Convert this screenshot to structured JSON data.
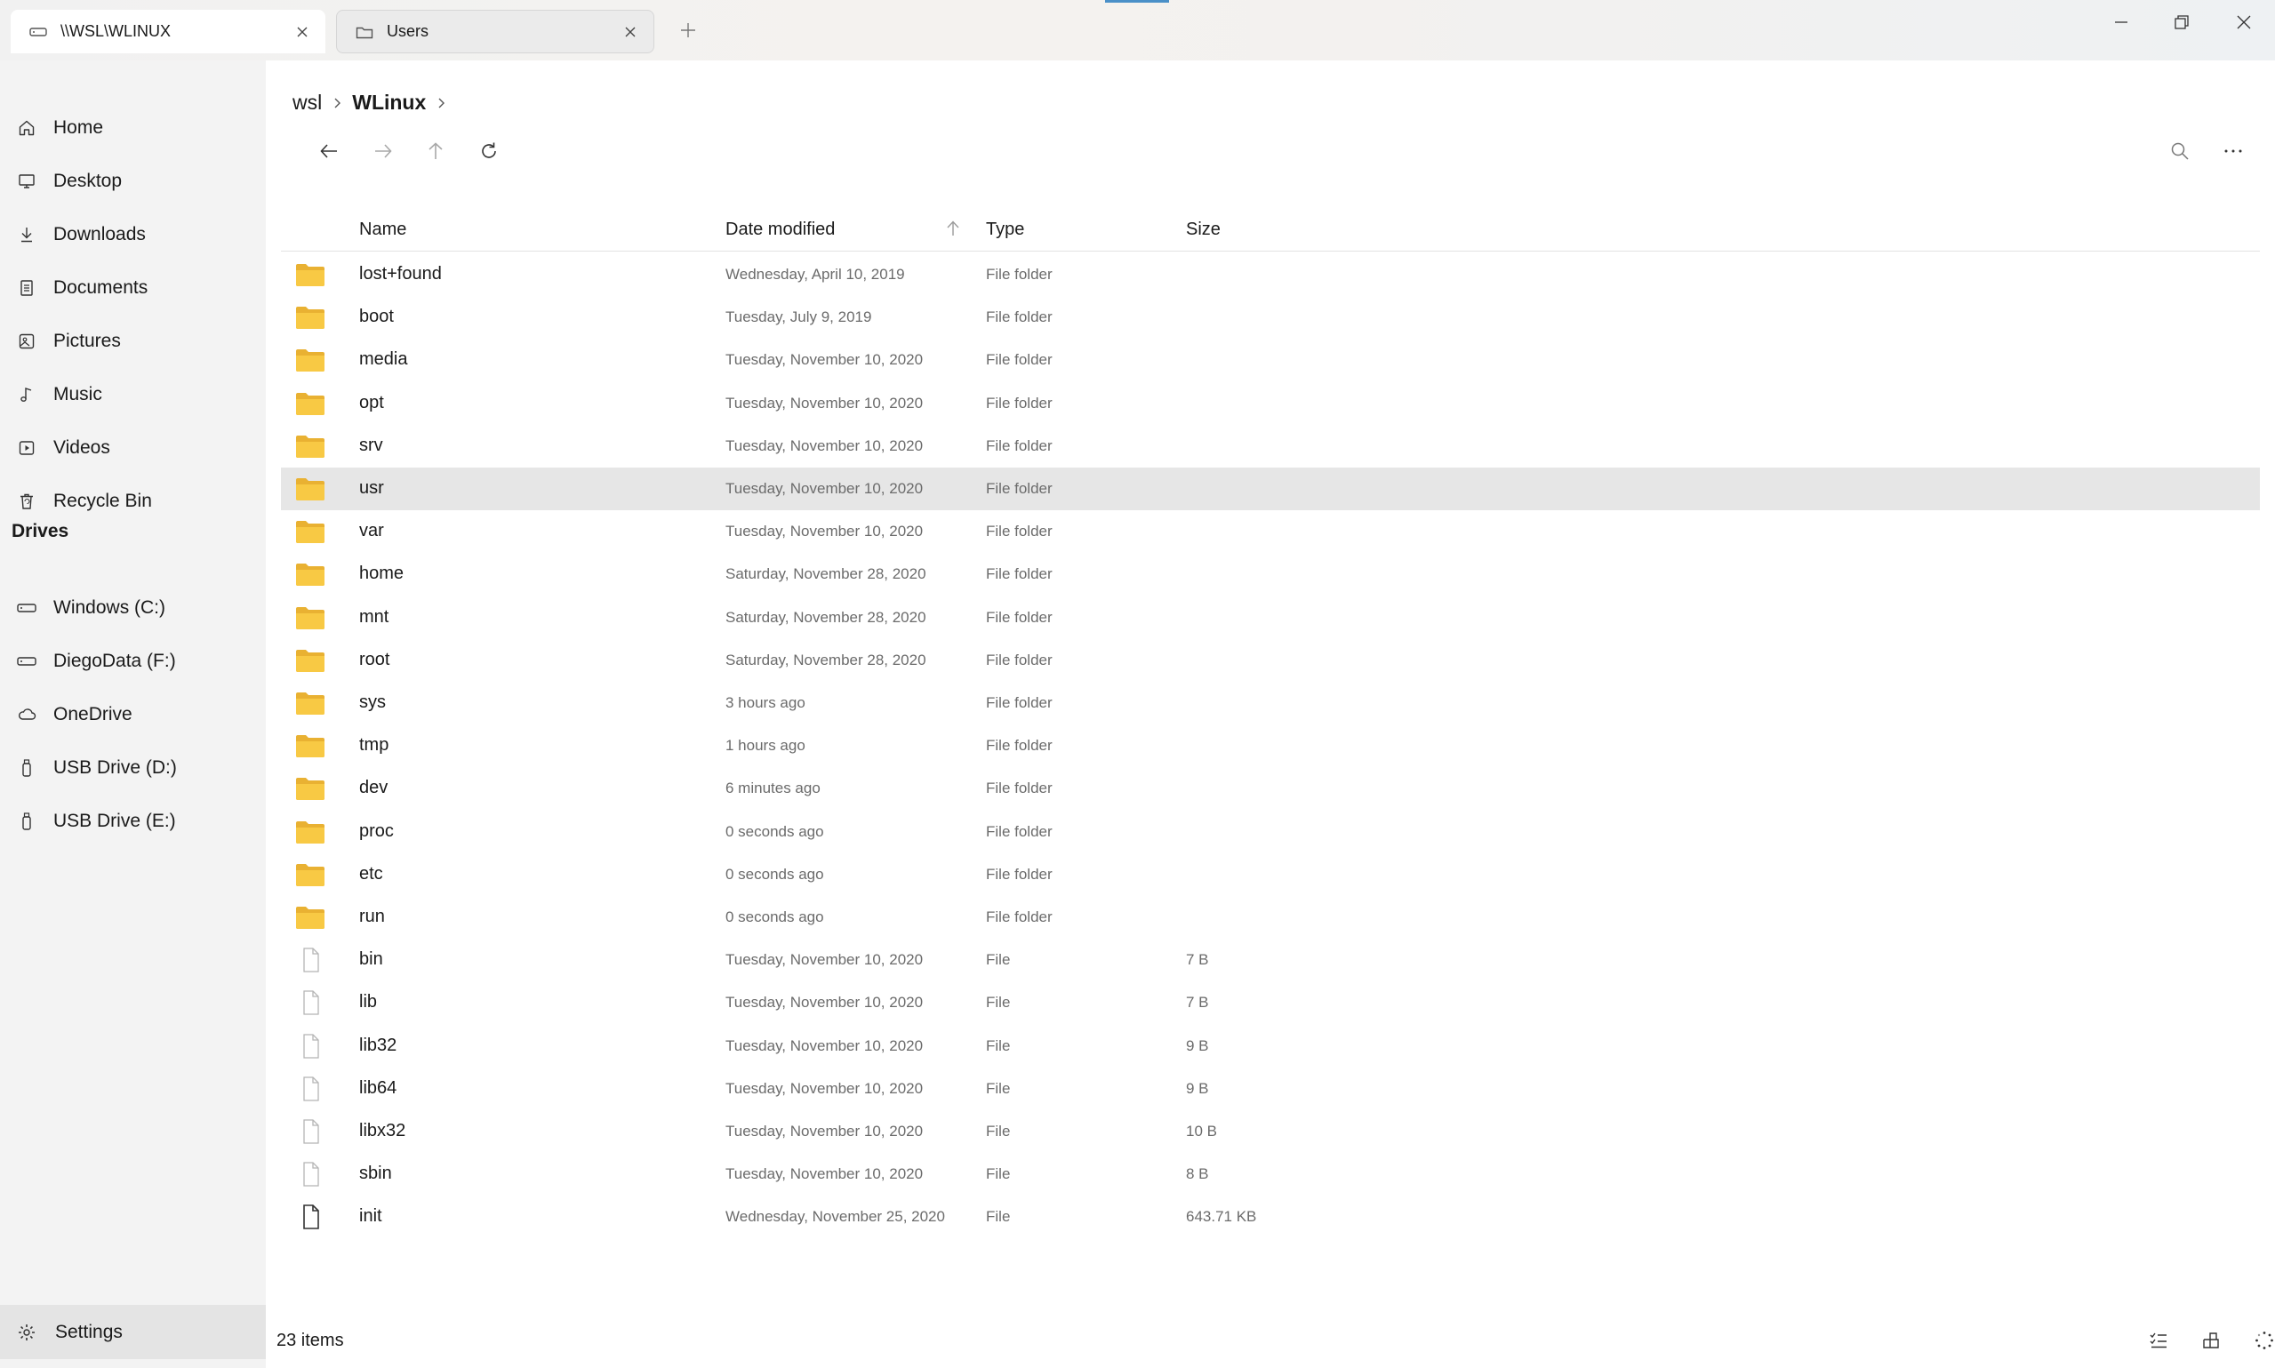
{
  "tabs": [
    {
      "label": "\\\\WSL\\WLINUX",
      "icon": "drive-icon",
      "active": true
    },
    {
      "label": "Users",
      "icon": "folder-icon",
      "active": false
    }
  ],
  "sidebar": {
    "items": [
      {
        "label": "Home",
        "icon": "home-icon"
      },
      {
        "label": "Desktop",
        "icon": "desktop-icon"
      },
      {
        "label": "Downloads",
        "icon": "download-icon"
      },
      {
        "label": "Documents",
        "icon": "document-icon"
      },
      {
        "label": "Pictures",
        "icon": "picture-icon"
      },
      {
        "label": "Music",
        "icon": "music-icon"
      },
      {
        "label": "Videos",
        "icon": "video-icon"
      },
      {
        "label": "Recycle Bin",
        "icon": "recycle-bin-icon"
      }
    ],
    "drives_header": "Drives",
    "drives": [
      {
        "label": "Windows (C:)",
        "icon": "drive-icon"
      },
      {
        "label": "DiegoData (F:)",
        "icon": "drive-icon"
      },
      {
        "label": "OneDrive",
        "icon": "cloud-icon"
      },
      {
        "label": "USB Drive (D:)",
        "icon": "usb-icon"
      },
      {
        "label": "USB Drive (E:)",
        "icon": "usb-icon"
      }
    ],
    "settings_label": "Settings"
  },
  "breadcrumb": {
    "items": [
      "wsl",
      "WLinux"
    ]
  },
  "columns": {
    "name": "Name",
    "date": "Date modified",
    "type": "Type",
    "size": "Size"
  },
  "files": [
    {
      "name": "lost+found",
      "date": "Wednesday, April 10, 2019",
      "type": "File folder",
      "size": "",
      "kind": "folder"
    },
    {
      "name": "boot",
      "date": "Tuesday, July 9, 2019",
      "type": "File folder",
      "size": "",
      "kind": "folder"
    },
    {
      "name": "media",
      "date": "Tuesday, November 10, 2020",
      "type": "File folder",
      "size": "",
      "kind": "folder"
    },
    {
      "name": "opt",
      "date": "Tuesday, November 10, 2020",
      "type": "File folder",
      "size": "",
      "kind": "folder"
    },
    {
      "name": "srv",
      "date": "Tuesday, November 10, 2020",
      "type": "File folder",
      "size": "",
      "kind": "folder"
    },
    {
      "name": "usr",
      "date": "Tuesday, November 10, 2020",
      "type": "File folder",
      "size": "",
      "kind": "folder",
      "selected": true
    },
    {
      "name": "var",
      "date": "Tuesday, November 10, 2020",
      "type": "File folder",
      "size": "",
      "kind": "folder"
    },
    {
      "name": "home",
      "date": "Saturday, November 28, 2020",
      "type": "File folder",
      "size": "",
      "kind": "folder"
    },
    {
      "name": "mnt",
      "date": "Saturday, November 28, 2020",
      "type": "File folder",
      "size": "",
      "kind": "folder"
    },
    {
      "name": "root",
      "date": "Saturday, November 28, 2020",
      "type": "File folder",
      "size": "",
      "kind": "folder"
    },
    {
      "name": "sys",
      "date": "3 hours ago",
      "type": "File folder",
      "size": "",
      "kind": "folder"
    },
    {
      "name": "tmp",
      "date": "1 hours ago",
      "type": "File folder",
      "size": "",
      "kind": "folder"
    },
    {
      "name": "dev",
      "date": "6 minutes ago",
      "type": "File folder",
      "size": "",
      "kind": "folder"
    },
    {
      "name": "proc",
      "date": "0 seconds ago",
      "type": "File folder",
      "size": "",
      "kind": "folder"
    },
    {
      "name": "etc",
      "date": "0 seconds ago",
      "type": "File folder",
      "size": "",
      "kind": "folder"
    },
    {
      "name": "run",
      "date": "0 seconds ago",
      "type": "File folder",
      "size": "",
      "kind": "folder"
    },
    {
      "name": "bin",
      "date": "Tuesday, November 10, 2020",
      "type": "File",
      "size": "7 B",
      "kind": "link-file"
    },
    {
      "name": "lib",
      "date": "Tuesday, November 10, 2020",
      "type": "File",
      "size": "7 B",
      "kind": "link-file"
    },
    {
      "name": "lib32",
      "date": "Tuesday, November 10, 2020",
      "type": "File",
      "size": "9 B",
      "kind": "link-file"
    },
    {
      "name": "lib64",
      "date": "Tuesday, November 10, 2020",
      "type": "File",
      "size": "9 B",
      "kind": "link-file"
    },
    {
      "name": "libx32",
      "date": "Tuesday, November 10, 2020",
      "type": "File",
      "size": "10 B",
      "kind": "link-file"
    },
    {
      "name": "sbin",
      "date": "Tuesday, November 10, 2020",
      "type": "File",
      "size": "8 B",
      "kind": "link-file"
    },
    {
      "name": "init",
      "date": "Wednesday, November 25, 2020",
      "type": "File",
      "size": "643.71 KB",
      "kind": "file"
    }
  ],
  "status": {
    "item_count": "23 items"
  },
  "colors": {
    "folder": "#f8c944",
    "folder_back": "#e9b132",
    "selected_row": "#e6e6e6",
    "sidebar_bg": "#f3f3f3",
    "accent": "#4a90c8"
  }
}
